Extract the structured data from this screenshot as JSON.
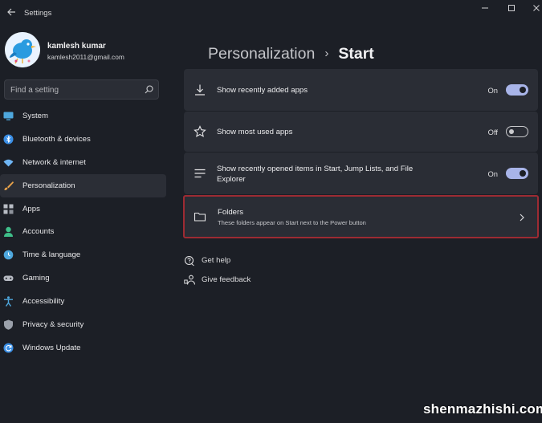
{
  "window": {
    "title": "Settings"
  },
  "user": {
    "name": "kamlesh kumar",
    "email": "kamlesh2011@gmail.com"
  },
  "search": {
    "placeholder": "Find a setting"
  },
  "sidebar": {
    "items": [
      {
        "label": "System",
        "icon": "monitor-icon",
        "color": "#4ea8de"
      },
      {
        "label": "Bluetooth & devices",
        "icon": "bluetooth-icon",
        "color": "#3b8fe6"
      },
      {
        "label": "Network & internet",
        "icon": "wifi-icon",
        "color": "#6fb6f5"
      },
      {
        "label": "Personalization",
        "icon": "brush-icon",
        "color": "#e8a24a",
        "active": true
      },
      {
        "label": "Apps",
        "icon": "apps-icon",
        "color": "#b8bcc4"
      },
      {
        "label": "Accounts",
        "icon": "person-icon",
        "color": "#3fbf8a"
      },
      {
        "label": "Time & language",
        "icon": "globe-clock-icon",
        "color": "#4ea8de"
      },
      {
        "label": "Gaming",
        "icon": "gamepad-icon",
        "color": "#b8bcc4"
      },
      {
        "label": "Accessibility",
        "icon": "accessibility-icon",
        "color": "#4ea8de"
      },
      {
        "label": "Privacy & security",
        "icon": "shield-icon",
        "color": "#9aa0aa"
      },
      {
        "label": "Windows Update",
        "icon": "update-icon",
        "color": "#3b8fe6"
      }
    ]
  },
  "breadcrumb": {
    "parent": "Personalization",
    "separator": "›",
    "current": "Start"
  },
  "settings": [
    {
      "label": "Show recently added apps",
      "state": "On",
      "on": true,
      "icon": "download-icon"
    },
    {
      "label": "Show most used apps",
      "state": "Off",
      "on": false,
      "icon": "star-icon"
    },
    {
      "label": "Show recently opened items in Start, Jump Lists, and File Explorer",
      "state": "On",
      "on": true,
      "icon": "list-icon"
    }
  ],
  "folders": {
    "title": "Folders",
    "subtitle": "These folders appear on Start next to the Power button"
  },
  "links": {
    "help": "Get help",
    "feedback": "Give feedback"
  },
  "watermark": "shenmazhishi.com",
  "colors": {
    "accent": "#a8b4e8",
    "highlight_border": "#9d2b33",
    "background": "#1c1f26",
    "card": "#2a2d35"
  }
}
